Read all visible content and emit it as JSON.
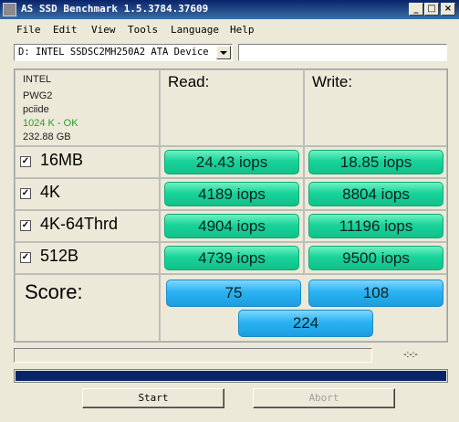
{
  "window": {
    "title": "AS SSD Benchmark 1.5.3784.37609",
    "controls": {
      "minimize": "_",
      "maximize": "□",
      "close": "×"
    }
  },
  "menu": [
    "File",
    "Edit",
    "View",
    "Tools",
    "Language",
    "Help"
  ],
  "device": {
    "selected": "D: INTEL SSDSC2MH250A2 ATA Device",
    "info_field": ""
  },
  "drive_info": {
    "vendor": "INTEL",
    "firmware": "PWG2",
    "driver": "pciide",
    "alignment": "1024 K - OK",
    "capacity": "232.88 GB",
    "alignment_color": "#2e9a2e"
  },
  "columns": {
    "read": "Read:",
    "write": "Write:"
  },
  "tests": [
    {
      "label": "16MB",
      "checked": true,
      "read": "24.43 iops",
      "write": "18.85 iops"
    },
    {
      "label": "4K",
      "checked": true,
      "read": "4189 iops",
      "write": "8804 iops"
    },
    {
      "label": "4K-64Thrd",
      "checked": true,
      "read": "4904 iops",
      "write": "11196 iops"
    },
    {
      "label": "512B",
      "checked": true,
      "read": "4739 iops",
      "write": "9500 iops"
    }
  ],
  "score": {
    "label": "Score:",
    "read": "75",
    "write": "108",
    "total": "224"
  },
  "status": {
    "elapsed": "-:-:-",
    "progress": 1.0
  },
  "buttons": {
    "start": "Start",
    "abort": "Abort"
  },
  "colors": {
    "result_green": "#19d49a",
    "score_blue": "#2ab2f2",
    "progress": "#0a246a"
  }
}
